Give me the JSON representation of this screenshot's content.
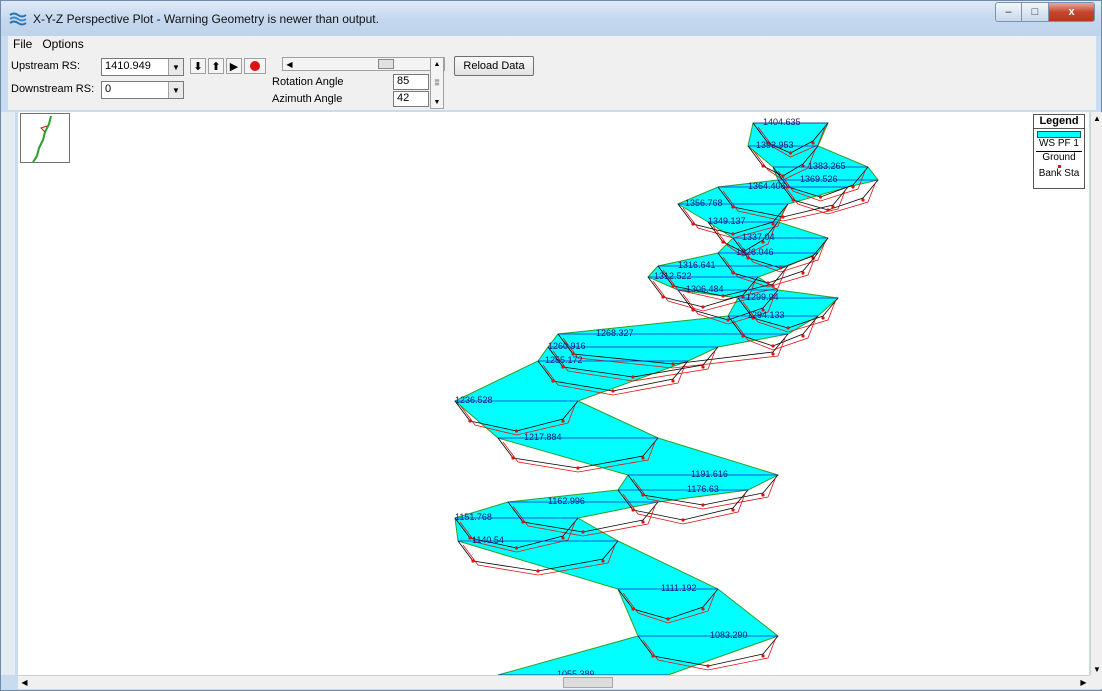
{
  "window": {
    "title": "X-Y-Z Perspective Plot - Warning Geometry is newer than output.",
    "icon": "hec-ras-icon",
    "buttons": {
      "minimize": "–",
      "maximize": "□",
      "close": "x"
    }
  },
  "menu": {
    "file": "File",
    "options": "Options"
  },
  "toolbar": {
    "upstream_label": "Upstream RS:",
    "upstream_value": "1410.949",
    "downstream_label": "Downstream RS:",
    "downstream_value": "0",
    "rotation_label": "Rotation Angle",
    "rotation_value": "85",
    "azimuth_label": "Azimuth Angle",
    "azimuth_value": "42",
    "reload_label": "Reload Data",
    "icons": [
      "arrow-down-icon",
      "arrow-up-icon",
      "play-icon",
      "record-icon"
    ]
  },
  "legend": {
    "title": "Legend",
    "items": [
      "WS PF 1",
      "Ground",
      "Bank Sta"
    ],
    "colors": {
      "ws": "#00ffff",
      "ground": "#000000",
      "bank": "#e01010",
      "outline": "#e01010",
      "centerline": "#1f1fcf"
    }
  },
  "stations": [
    "1404.635",
    "1393.953",
    "1383.265",
    "1369.526",
    "1364.406",
    "1356.768",
    "1349.137",
    "1337.04",
    "1326.046",
    "1316.641",
    "1312.522",
    "1306.484",
    "1299.94",
    "1294.133",
    "1268.327",
    "1260.916",
    "1255.172",
    "1236.528",
    "1217.884",
    "1191.616",
    "1176.63",
    "1162.996",
    "1151.768",
    "1140.54",
    "1111.192",
    "1083.290",
    "1055.389"
  ]
}
